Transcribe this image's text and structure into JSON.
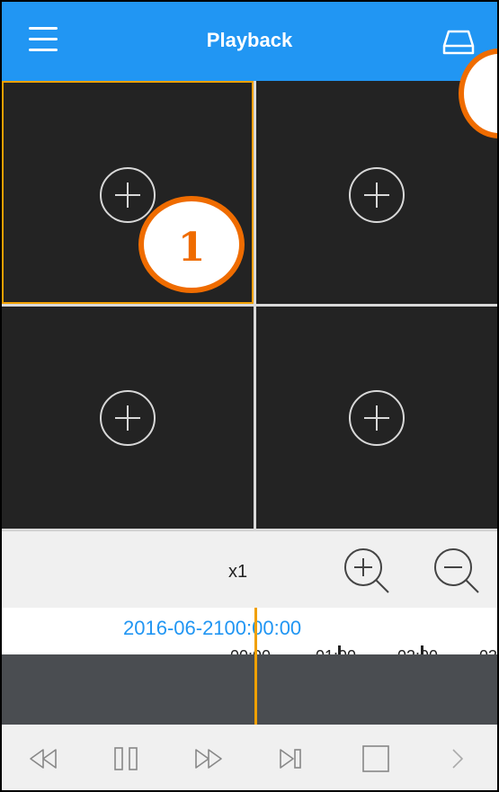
{
  "header": {
    "title": "Playback",
    "menu_icon": "hamburger-icon",
    "device_icon": "hard-drive-icon"
  },
  "grid": {
    "cells": [
      {
        "id": "top-left",
        "selected": true,
        "icon": "add-circle-icon"
      },
      {
        "id": "top-right",
        "selected": false,
        "icon": "add-circle-icon"
      },
      {
        "id": "bottom-left",
        "selected": false,
        "icon": "add-circle-icon"
      },
      {
        "id": "bottom-right",
        "selected": false,
        "icon": "add-circle-icon"
      }
    ]
  },
  "callouts": [
    {
      "label": "1"
    },
    {
      "label": ""
    }
  ],
  "controls": {
    "speed": "x1",
    "zoom_in_icon": "zoom-in-icon",
    "zoom_out_icon": "zoom-out-icon"
  },
  "timeline": {
    "datetime": "2016-06-2100:00:00",
    "ticks": [
      "00:00",
      "01:00",
      "02:00",
      "03"
    ]
  },
  "bottom_bar": {
    "buttons": [
      "rewind-icon",
      "pause-icon",
      "fast-forward-icon",
      "step-forward-icon",
      "stop-icon",
      "next-icon"
    ]
  },
  "colors": {
    "header": "#2196f3",
    "accent": "#f0a000",
    "callout": "#ef6c00",
    "cell_bg": "#232323",
    "timeline_dark": "#4a4d51"
  }
}
